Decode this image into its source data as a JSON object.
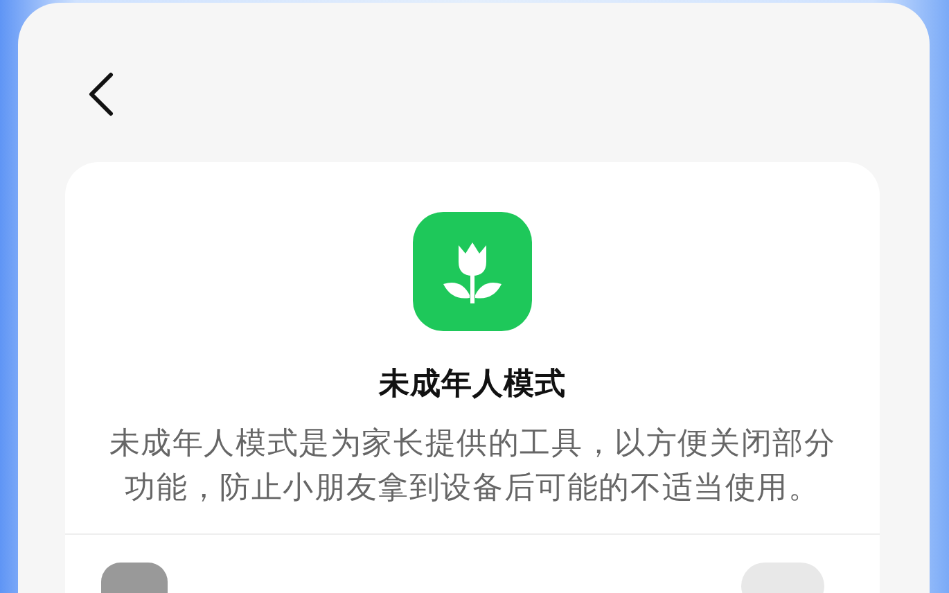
{
  "title": "未成年人模式",
  "description": "未成年人模式是为家长提供的工具，以方便关闭部分功能，防止小朋友拿到设备后可能的不适当使用。",
  "toggle": {
    "on": false
  }
}
